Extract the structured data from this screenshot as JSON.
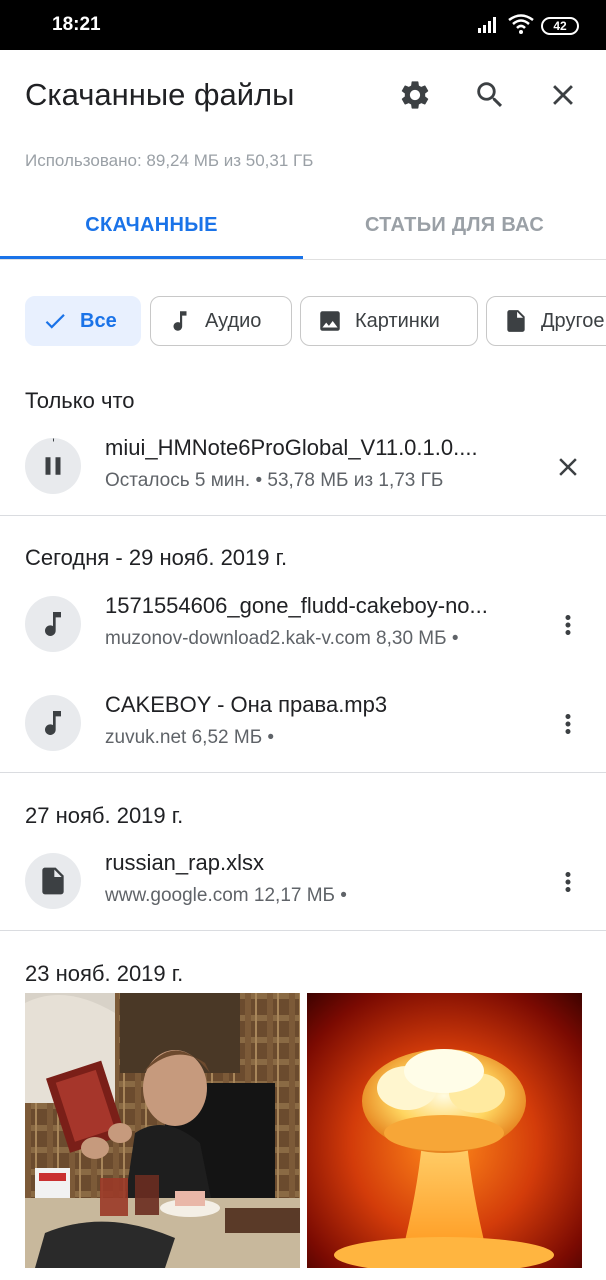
{
  "status_bar": {
    "time": "18:21",
    "battery": "42"
  },
  "header": {
    "title": "Скачанные файлы"
  },
  "storage_text": "Использовано: 89,24 МБ из 50,31 ГБ",
  "tabs": [
    {
      "label": "СКАЧАННЫЕ",
      "active": true
    },
    {
      "label": "СТАТЬИ ДЛЯ ВАС",
      "active": false
    }
  ],
  "filters": [
    {
      "label": "Все",
      "icon": "check-icon",
      "selected": true
    },
    {
      "label": "Аудио",
      "icon": "music-note-icon",
      "selected": false
    },
    {
      "label": "Картинки",
      "icon": "image-icon",
      "selected": false
    },
    {
      "label": "Другое",
      "icon": "document-icon",
      "selected": false
    }
  ],
  "sections": [
    {
      "title": "Только что",
      "items": [
        {
          "name": "miui_HMNote6ProGlobal_V11.0.1.0....",
          "meta": "Осталось 5 мин. • 53,78 МБ из 1,73 ГБ",
          "icon": "pause-icon",
          "action": "close-icon"
        }
      ]
    },
    {
      "title": "Сегодня - 29 нояб. 2019 г.",
      "items": [
        {
          "name": "1571554606_gone_fludd-cakeboy-no...",
          "meta": "muzonov-download2.kak-v.com 8,30 МБ •",
          "icon": "music-note-icon",
          "action": "more-vert-icon"
        },
        {
          "name": "CAKEBOY - Она права.mp3",
          "meta": "zuvuk.net 6,52 МБ •",
          "icon": "music-note-icon",
          "action": "more-vert-icon"
        }
      ]
    },
    {
      "title": "27 нояб. 2019 г.",
      "items": [
        {
          "name": "russian_rap.xlsx",
          "meta": "www.google.com 12,17 МБ •",
          "icon": "document-icon",
          "action": "more-vert-icon"
        }
      ]
    },
    {
      "title": "23 нояб. 2019 г.",
      "images": [
        "photo-thumbnail",
        "explosion-thumbnail"
      ]
    }
  ],
  "colors": {
    "accent": "#1a73e8",
    "chip_selected_bg": "#e8f0fe",
    "text_secondary": "#5f6368"
  }
}
